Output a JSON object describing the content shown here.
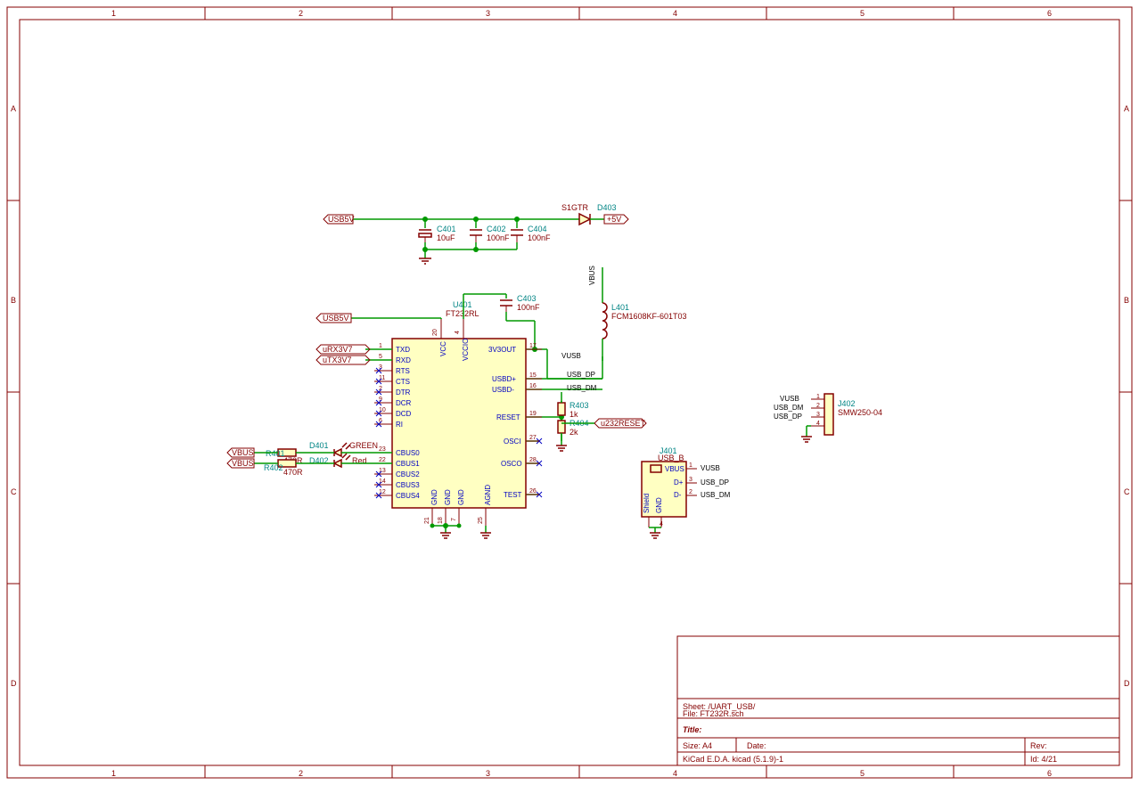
{
  "titleblock": {
    "sheet_label": "Sheet: /UART_USB/",
    "file_label": "File: FT232R.sch",
    "title_label": "Title:",
    "size_label": "Size: A4",
    "date_label": "Date:",
    "rev_label": "Rev:",
    "software_label": "KiCad E.D.A.  kicad (5.1.9)-1",
    "id_label": "Id: 4/21"
  },
  "grid_cols": [
    "1",
    "2",
    "3",
    "4",
    "5",
    "6"
  ],
  "grid_rows": [
    "A",
    "B",
    "C",
    "D"
  ],
  "U401": {
    "ref": "U401",
    "value": "FT232RL",
    "pins_left": [
      {
        "num": "1",
        "name": "TXD"
      },
      {
        "num": "5",
        "name": "RXD"
      },
      {
        "num": "3",
        "name": "RTS"
      },
      {
        "num": "11",
        "name": "CTS"
      },
      {
        "num": "2",
        "name": "DTR"
      },
      {
        "num": "9",
        "name": "DCR"
      },
      {
        "num": "10",
        "name": "DCD"
      },
      {
        "num": "6",
        "name": "RI"
      },
      {
        "num": "23",
        "name": "CBUS0"
      },
      {
        "num": "22",
        "name": "CBUS1"
      },
      {
        "num": "13",
        "name": "CBUS2"
      },
      {
        "num": "14",
        "name": "CBUS3"
      },
      {
        "num": "12",
        "name": "CBUS4"
      }
    ],
    "pins_right": [
      {
        "num": "17",
        "name": "3V3OUT"
      },
      {
        "num": "15",
        "name": "USBD+"
      },
      {
        "num": "16",
        "name": "USBD-"
      },
      {
        "num": "19",
        "name": "RESET"
      },
      {
        "num": "27",
        "name": "OSCI"
      },
      {
        "num": "28",
        "name": "OSCO"
      },
      {
        "num": "26",
        "name": "TEST"
      }
    ],
    "pins_top": [
      {
        "num": "20",
        "name": "VCC"
      },
      {
        "num": "4",
        "name": "VCCIO"
      }
    ],
    "pins_bot": [
      {
        "num": "21",
        "name": "GND"
      },
      {
        "num": "18",
        "name": "GND"
      },
      {
        "num": "7",
        "name": "GND"
      },
      {
        "num": "25",
        "name": "AGND"
      }
    ]
  },
  "J401": {
    "ref": "J401",
    "value": "USB_B",
    "vbus": "VBUS",
    "dp": "D+",
    "dm": "D-",
    "shield": "Shield",
    "gnd": "GND",
    "p1": "1",
    "p2": "2",
    "p3": "3",
    "p4": "4",
    "n1": "VUSB",
    "n2": "USB_DM",
    "n3": "USB_DP"
  },
  "J402": {
    "ref": "J402",
    "value": "SMW250-04",
    "p1": "1",
    "p2": "2",
    "p3": "3",
    "p4": "4",
    "n1": "VUSB",
    "n2": "USB_DM",
    "n3": "USB_DP"
  },
  "C401": {
    "ref": "C401",
    "value": "10uF"
  },
  "C402": {
    "ref": "C402",
    "value": "100nF"
  },
  "C403": {
    "ref": "C403",
    "value": "100nF"
  },
  "C404": {
    "ref": "C404",
    "value": "100nF"
  },
  "R401": {
    "ref": "R401",
    "value": "470R"
  },
  "R402": {
    "ref": "R402",
    "value": "470R"
  },
  "R403": {
    "ref": "R403",
    "value": "1k"
  },
  "R404": {
    "ref": "R404",
    "value": "2k"
  },
  "D401": {
    "ref": "D401",
    "value": "GREEN"
  },
  "D402": {
    "ref": "D402",
    "value": "Red"
  },
  "D403": {
    "ref": "D403",
    "value": "S1GTR"
  },
  "L401": {
    "ref": "L401",
    "value": "FCM1608KF-601T03"
  },
  "labels": {
    "usb5v_1": "USB5V",
    "usb5v_2": "USB5V",
    "plus5v": "+5V",
    "urx": "uRX3V7",
    "utx": "uTX3V7",
    "u232reset": "u232RESET",
    "vbus_1": "VBUS",
    "vbus_2": "VBUS",
    "vbus_top": "VBUS",
    "vusb": "VUSB",
    "usb_dp": "USB_DP",
    "usb_dm": "USB_DM"
  }
}
